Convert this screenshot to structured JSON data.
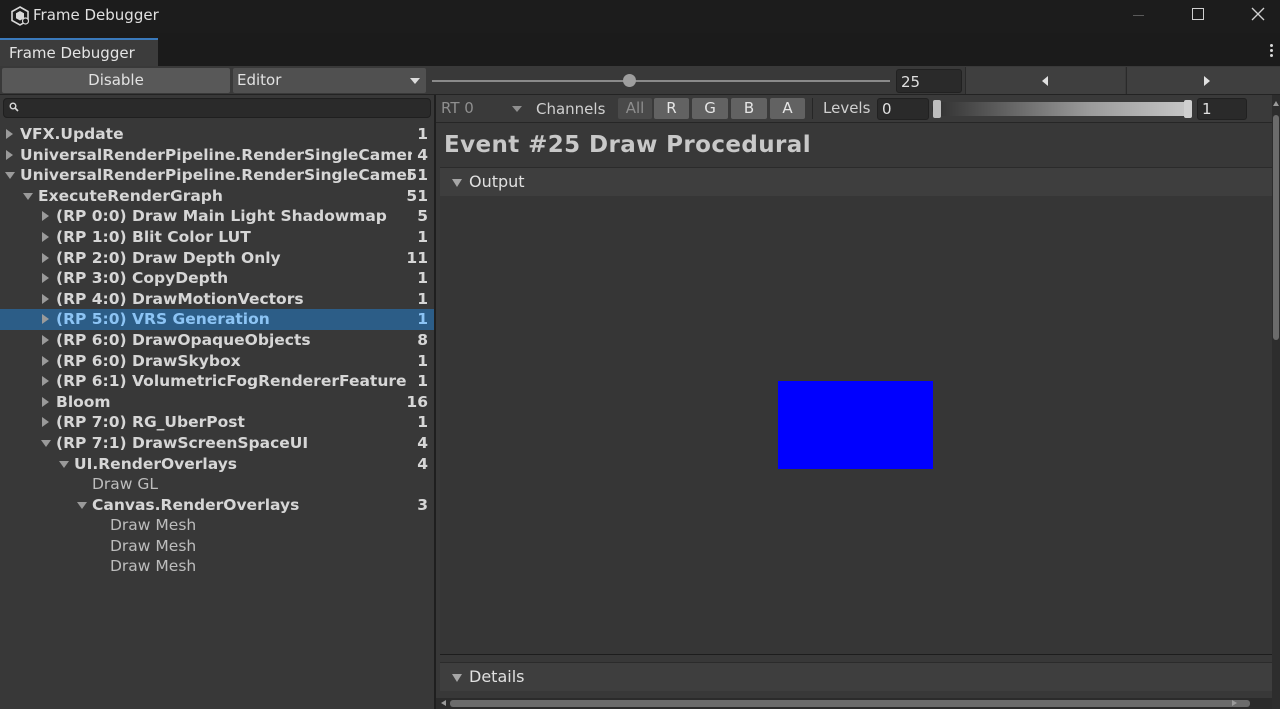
{
  "window": {
    "title": "Frame Debugger",
    "icons": [
      "unity-app-icon",
      "minimize-icon",
      "maximize-icon",
      "close-icon"
    ]
  },
  "tab": {
    "label": "Frame Debugger"
  },
  "toolbar": {
    "disable_label": "Disable",
    "target_selected": "Editor",
    "event_index": "25",
    "event_slider_fraction": 0.43,
    "prev_icon": "triangle-left-icon",
    "next_icon": "triangle-right-icon"
  },
  "search": {
    "value": "",
    "icon": "search-icon"
  },
  "tree": [
    {
      "indent": 0,
      "arrow": "closed",
      "label": "VFX.Update",
      "count": "1",
      "style": "bold"
    },
    {
      "indent": 0,
      "arrow": "closed",
      "label": "UniversalRenderPipeline.RenderSingleCameraI",
      "count": "4",
      "style": "bold"
    },
    {
      "indent": 0,
      "arrow": "open",
      "label": "UniversalRenderPipeline.RenderSingleCamera",
      "count": "51",
      "style": "bold"
    },
    {
      "indent": 1,
      "arrow": "open",
      "label": "ExecuteRenderGraph",
      "count": "51",
      "style": "bold"
    },
    {
      "indent": 2,
      "arrow": "closed",
      "label": "(RP 0:0) Draw Main Light Shadowmap",
      "count": "5",
      "style": "bold"
    },
    {
      "indent": 2,
      "arrow": "closed",
      "label": "(RP 1:0) Blit Color LUT",
      "count": "1",
      "style": "bold"
    },
    {
      "indent": 2,
      "arrow": "closed",
      "label": "(RP 2:0) Draw Depth Only",
      "count": "11",
      "style": "bold"
    },
    {
      "indent": 2,
      "arrow": "closed",
      "label": "(RP 3:0) CopyDepth",
      "count": "1",
      "style": "bold"
    },
    {
      "indent": 2,
      "arrow": "closed",
      "label": "(RP 4:0) DrawMotionVectors",
      "count": "1",
      "style": "bold"
    },
    {
      "indent": 2,
      "arrow": "closed",
      "label": "(RP 5:0) VRS Generation",
      "count": "1",
      "style": "bold",
      "selected": true
    },
    {
      "indent": 2,
      "arrow": "closed",
      "label": "(RP 6:0) DrawOpaqueObjects",
      "count": "8",
      "style": "bold"
    },
    {
      "indent": 2,
      "arrow": "closed",
      "label": "(RP 6:0) DrawSkybox",
      "count": "1",
      "style": "bold"
    },
    {
      "indent": 2,
      "arrow": "closed",
      "label": "(RP 6:1) VolumetricFogRendererFeature",
      "count": "1",
      "style": "bold"
    },
    {
      "indent": 2,
      "arrow": "closed",
      "label": "Bloom",
      "count": "16",
      "style": "bold"
    },
    {
      "indent": 2,
      "arrow": "closed",
      "label": "(RP 7:0) RG_UberPost",
      "count": "1",
      "style": "bold"
    },
    {
      "indent": 2,
      "arrow": "open",
      "label": "(RP 7:1) DrawScreenSpaceUI",
      "count": "4",
      "style": "bold"
    },
    {
      "indent": 3,
      "arrow": "open",
      "label": "UI.RenderOverlays",
      "count": "4",
      "style": "bold"
    },
    {
      "indent": 4,
      "arrow": "none",
      "label": "Draw GL",
      "count": "",
      "style": "dim"
    },
    {
      "indent": 4,
      "arrow": "open",
      "label": "Canvas.RenderOverlays",
      "count": "3",
      "style": "bold"
    },
    {
      "indent": 5,
      "arrow": "none",
      "label": "Draw Mesh",
      "count": "",
      "style": "dim"
    },
    {
      "indent": 5,
      "arrow": "none",
      "label": "Draw Mesh",
      "count": "",
      "style": "dim"
    },
    {
      "indent": 5,
      "arrow": "none",
      "label": "Draw Mesh",
      "count": "",
      "style": "dim"
    }
  ],
  "viewer": {
    "rt_selected": "RT 0",
    "channels_label": "Channels",
    "channel_all": "All",
    "channel_r": "R",
    "channel_g": "G",
    "channel_b": "B",
    "channel_a": "A",
    "levels_label": "Levels",
    "levels_min": "0",
    "levels_max": "1",
    "event_title": "Event #25 Draw Procedural",
    "output_label": "Output",
    "details_label": "Details",
    "preview_color": "#0000ff"
  },
  "colors": {
    "selection_bg": "#2c5d87",
    "selection_text": "#8cc4f5",
    "tab_accent": "#3a79bb"
  }
}
